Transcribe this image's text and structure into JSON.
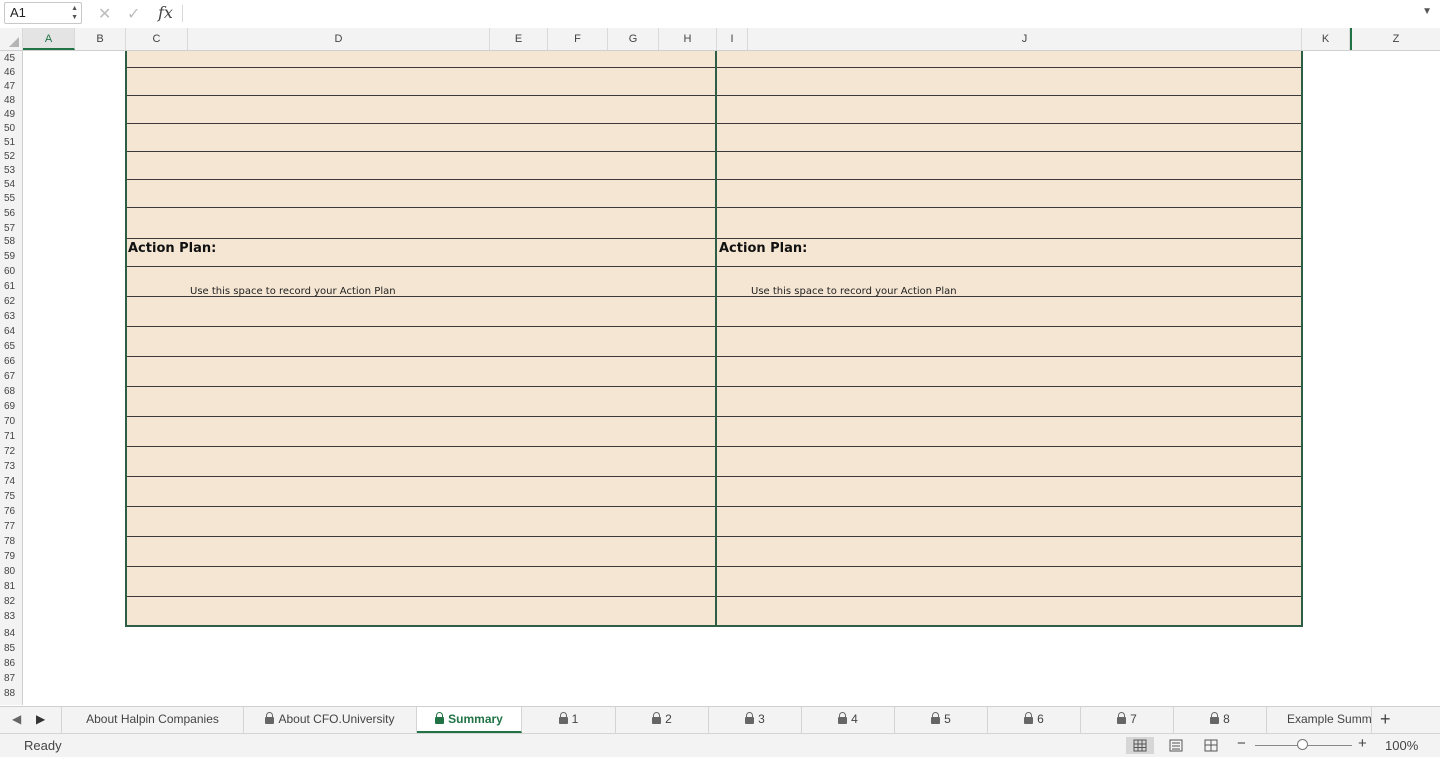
{
  "formula_bar": {
    "name_box": "A1",
    "fx": "fx",
    "formula": ""
  },
  "columns": [
    {
      "label": "A",
      "active": true
    },
    {
      "label": "B"
    },
    {
      "label": "C"
    },
    {
      "label": "D"
    },
    {
      "label": "E"
    },
    {
      "label": "F"
    },
    {
      "label": "G"
    },
    {
      "label": "H"
    },
    {
      "label": "I"
    },
    {
      "label": "J"
    },
    {
      "label": "K"
    },
    {
      "label": "Z"
    }
  ],
  "rows": [
    "45",
    "46",
    "47",
    "48",
    "49",
    "50",
    "51",
    "52",
    "53",
    "54",
    "55",
    "56",
    "57",
    "58",
    "59",
    "60",
    "61",
    "62",
    "63",
    "64",
    "65",
    "66",
    "67",
    "68",
    "69",
    "70",
    "71",
    "72",
    "73",
    "74",
    "75",
    "76",
    "77",
    "78",
    "79",
    "80",
    "81",
    "82",
    "83",
    "84",
    "85",
    "86",
    "87",
    "88"
  ],
  "left_panel": {
    "heading": "Action Plan:",
    "hint": "Use this space to record your Action Plan"
  },
  "right_panel": {
    "heading": "Action Plan:",
    "hint": "Use this space to record your Action Plan"
  },
  "sheet_tabs": [
    {
      "label": "About Halpin Companies",
      "locked": false
    },
    {
      "label": "About CFO.University",
      "locked": true
    },
    {
      "label": "Summary",
      "locked": true,
      "active": true
    },
    {
      "label": "1",
      "locked": true
    },
    {
      "label": "2",
      "locked": true
    },
    {
      "label": "3",
      "locked": true
    },
    {
      "label": "4",
      "locked": true
    },
    {
      "label": "5",
      "locked": true
    },
    {
      "label": "6",
      "locked": true
    },
    {
      "label": "7",
      "locked": true
    },
    {
      "label": "8",
      "locked": true
    },
    {
      "label": "Example Summ",
      "locked": false
    }
  ],
  "add_sheet": "+",
  "status": {
    "text": "Ready",
    "zoom": "100%",
    "zoom_minus": "−",
    "zoom_plus": "+"
  },
  "colors": {
    "accent": "#217346",
    "panel_fill": "#f5e6d3",
    "panel_border": "#2e5e46"
  }
}
